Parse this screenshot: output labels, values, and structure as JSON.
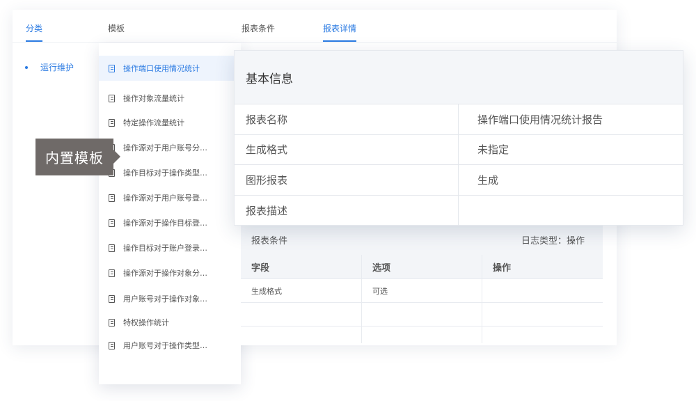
{
  "tabs": {
    "category": "分类",
    "template": "模板",
    "conditions": "报表条件",
    "details": "报表详情"
  },
  "categories": [
    "运行维护"
  ],
  "templates": [
    "操作端口使用情况统计",
    "操作对象流量统计",
    "特定操作流量统计",
    "操作源对于用户账号分…",
    "操作目标对于操作类型…",
    "操作源对于用户账号登…",
    "操作源对于操作目标登…",
    "操作目标对于账户登录…",
    "操作源对于操作对象分…",
    "用户账号对于操作对象…",
    "特权操作统计",
    "用户账号对于操作类型…"
  ],
  "tooltip": "内置模板",
  "basic_info": {
    "title": "基本信息",
    "rows": [
      {
        "label": "报表名称",
        "value": "操作端口使用情况统计报告"
      },
      {
        "label": "生成格式",
        "value": "未指定"
      },
      {
        "label": "图形报表",
        "value": "生成"
      },
      {
        "label": "报表描述",
        "value": ""
      }
    ]
  },
  "conditions": {
    "title": "报表条件",
    "log_type": "日志类型：操作",
    "headers": [
      "字段",
      "选项",
      "操作"
    ],
    "rows": [
      [
        "生成格式",
        "可选",
        ""
      ],
      [
        "",
        "",
        ""
      ],
      [
        "",
        "",
        ""
      ]
    ]
  },
  "colors": {
    "accent": "#2a7ae2",
    "tooltip_bg": "#6f6a68",
    "header_bg": "#f4f6f9"
  },
  "icons": {
    "template_item": "document-icon"
  }
}
